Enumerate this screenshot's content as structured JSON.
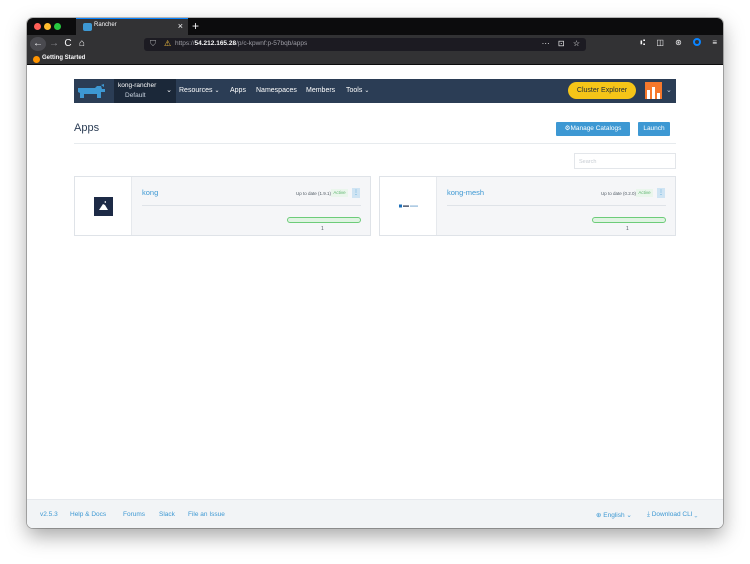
{
  "browser": {
    "tab_title": "Rancher",
    "tab_close": "×",
    "new_tab": "+",
    "back": "←",
    "forward": "→",
    "reload": "C",
    "home": "⌂",
    "url_prefix": "https://",
    "url_host": "54.212.165.28",
    "url_path": "/p/c-kpwnf:p-57bqb/apps",
    "url_more": "···",
    "url_pocket": "⊡",
    "url_star": "☆",
    "tool_library": "⑆",
    "tool_sidebar": "◫",
    "tool_account": "⊛",
    "tool_menu": "≡",
    "bookmark": "Getting Started"
  },
  "header": {
    "cluster_name": "kong-rancher",
    "project_name": "Default",
    "chevron": "⌄",
    "nav": [
      "Resources",
      "Apps",
      "Namespaces",
      "Members",
      "Tools"
    ],
    "caret": "⌄",
    "cluster_explorer": "Cluster Explorer",
    "avatar_chevron": "⌄"
  },
  "page": {
    "title": "Apps",
    "manage_catalogs": "Manage Catalogs",
    "launch": "Launch",
    "search_placeholder": "Search"
  },
  "apps": [
    {
      "name": "kong",
      "status": "Up to date (1.9.1)",
      "state": "Active",
      "menu": "⋮",
      "count": "1"
    },
    {
      "name": "kong-mesh",
      "status": "Up to date (0.2.0)",
      "state": "Active",
      "menu": "⋮",
      "count": "1"
    }
  ],
  "footer": {
    "version": "v2.5.3",
    "help": "Help & Docs",
    "forums": "Forums",
    "slack": "Slack",
    "issue": "File an Issue",
    "language": "English",
    "download": "Download CLI"
  },
  "colors": {
    "header_bg": "#2b3d55",
    "accent": "#3d98d3",
    "explorer_yellow": "#f5c518",
    "active_green": "#5db56e"
  }
}
